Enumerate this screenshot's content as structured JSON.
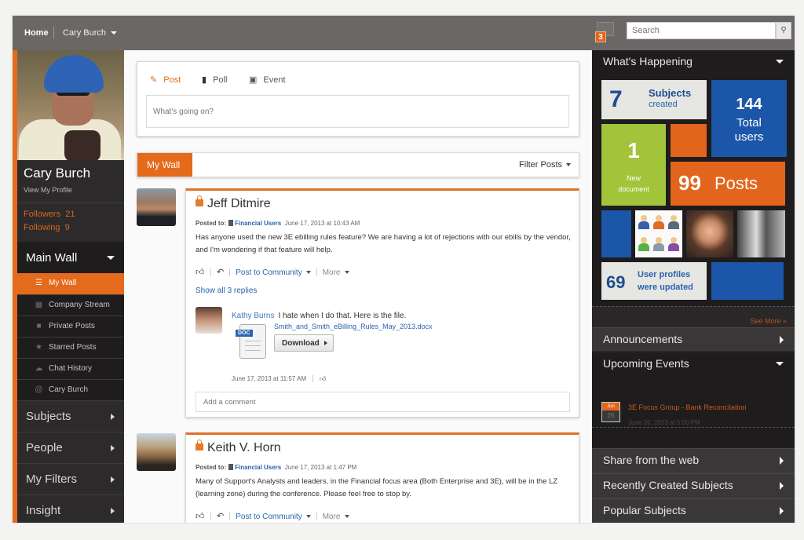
{
  "topbar": {
    "home": "Home",
    "user": "Cary Burch",
    "notification_count": "3",
    "search_placeholder": "Search",
    "search_icon": "search-icon"
  },
  "profile": {
    "name": "Cary Burch",
    "view_profile": "View My Profile",
    "followers_label": "Followers",
    "followers_count": "21",
    "following_label": "Following",
    "following_count": "9"
  },
  "sidebar": {
    "main_wall": "Main Wall",
    "sub_items": [
      {
        "label": "My Wall",
        "icon": "list-icon",
        "active": true
      },
      {
        "label": "Company Stream",
        "icon": "grid-icon"
      },
      {
        "label": "Private Posts",
        "icon": "lock-icon"
      },
      {
        "label": "Starred Posts",
        "icon": "star-icon"
      },
      {
        "label": "Chat History",
        "icon": "chat-icon"
      },
      {
        "label": "Cary Burch",
        "icon": "at-icon"
      }
    ],
    "sections": [
      {
        "label": "Subjects"
      },
      {
        "label": "People"
      },
      {
        "label": "My Filters"
      },
      {
        "label": "Insight"
      }
    ]
  },
  "composer": {
    "tabs": [
      {
        "label": "Post",
        "icon": "pencil-icon",
        "active": true
      },
      {
        "label": "Poll",
        "icon": "bar-chart-icon"
      },
      {
        "label": "Event",
        "icon": "calendar-icon"
      }
    ],
    "placeholder": "What's going on?"
  },
  "wall": {
    "tab": "My Wall",
    "filter": "Filter Posts"
  },
  "posts": [
    {
      "author": "Jeff Ditmire",
      "posted_to_label": "Posted to:",
      "group": "Financial Users",
      "timestamp": "June 17, 2013 at 10:43 AM",
      "body": "Has anyone used the new 3E ebilling rules feature? We are having a lot of rejections with our ebills by the vendor, and I'm wondering if that feature will help.",
      "post_to_community": "Post to Community",
      "more": "More",
      "show_replies": "Show all 3 replies",
      "reply": {
        "author": "Kathy Burns",
        "text": "I hate when I do that. Here is the file.",
        "file_tag": "DOC",
        "file_name": "Smith_and_Smith_eBilling_Rules_May_2013.docx",
        "download": "Download",
        "timestamp": "June 17, 2013 at 11:57 AM"
      },
      "add_comment_placeholder": "Add a comment"
    },
    {
      "author": "Keith V. Horn",
      "posted_to_label": "Posted to:",
      "group": "Financial Users",
      "timestamp": "June 17, 2013 at 1:47 PM",
      "body": "Many of Support's Analysts and leaders, in the Financial focus area (Both Enterprise and 3E), will be in the LZ (learning zone) during the conference. Please feel free to stop by.",
      "post_to_community": "Post to Community",
      "more": "More"
    }
  ],
  "right": {
    "whats_happening": "What's Happening",
    "tiles": {
      "subjects_count": "7",
      "subjects_label": "Subjects",
      "subjects_sub": "created",
      "users_count": "144",
      "users_label": "Total users",
      "docs_count": "1",
      "docs_label": "New document",
      "posts_count": "99",
      "posts_label": "Posts",
      "profiles_count": "69",
      "profiles_label": "User profiles were updated"
    },
    "see_more": "See More »",
    "announcements": "Announcements",
    "upcoming_events": "Upcoming Events",
    "event": {
      "month": "Jun",
      "day": "26",
      "title": "3E Focus Group - Bank Reconcilation",
      "time": "June 26, 2013 at 5:00 PM"
    },
    "share_web": "Share from the web",
    "recent_subjects": "Recently Created Subjects",
    "popular_subjects": "Popular Subjects"
  },
  "colors": {
    "accent_orange": "#e46a1c",
    "link_blue": "#2a64ae",
    "tile_blue": "#1b56a9",
    "tile_green": "#a2c43a"
  }
}
